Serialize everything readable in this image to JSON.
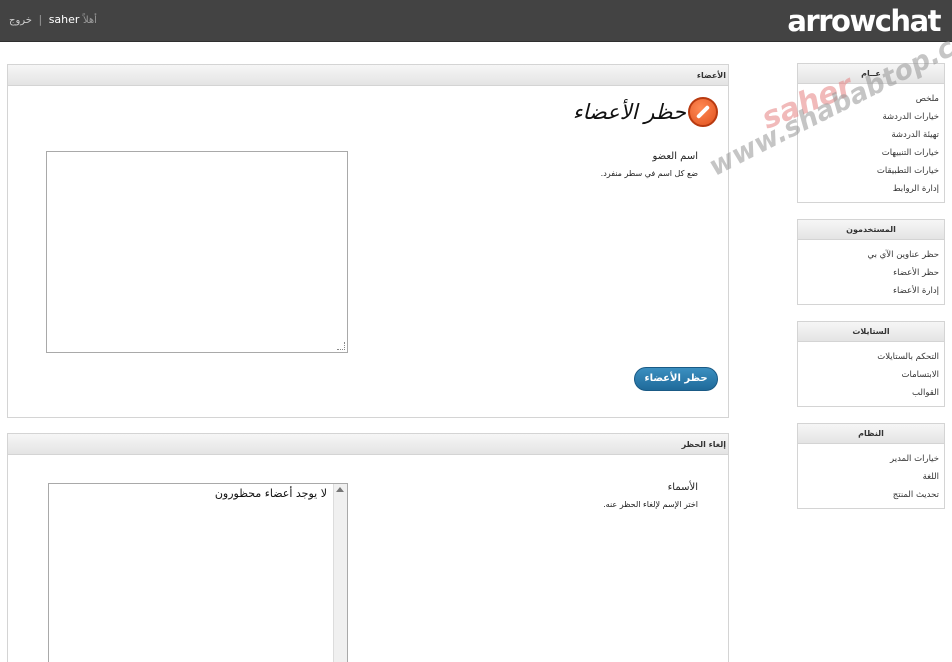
{
  "header": {
    "logo": "arrowchat",
    "greeting": "أهلاً",
    "username": "saher",
    "separator": "|",
    "logout": "خروج"
  },
  "sidebar": {
    "general": {
      "title": "عــام",
      "items": [
        "ملخص",
        "خيارات الدردشة",
        "تهيئة الدردشة",
        "خيارات التنبيهات",
        "خيارات التطبيقات",
        "إدارة الروابط"
      ]
    },
    "users": {
      "title": "المستخدمون",
      "items": [
        "حظر عناوين الآي بي",
        "حظر الأعضاء",
        "إدارة الأعضاء"
      ]
    },
    "styles": {
      "title": "الستايلات",
      "items": [
        "التحكم بالستايلات",
        "الابتسامات",
        "القوالب"
      ]
    },
    "system": {
      "title": "النظام",
      "items": [
        "خيارات المدير",
        "اللغة",
        "تحديث المنتج"
      ]
    }
  },
  "members_panel": {
    "header": "الأعضاء",
    "page_title": "حظر الأعضاء",
    "field_label": "اسم العضو",
    "field_help": "ضع كل اسم في سطر منفرد.",
    "button": "حظر الأعضاء"
  },
  "unban_panel": {
    "header": "إلغاء الحظر",
    "field_label": "الأسماء",
    "field_help": "اختر الإسم لإلغاء الحظر عنه.",
    "list_item": "لا يوجد أعضاء محظورون"
  },
  "watermark": {
    "name": "saher",
    "site": "www.shababtop.com"
  },
  "colors": {
    "topbar": "#434343",
    "button": "#2a7db0",
    "icon": "#e0501c"
  },
  "icons": {
    "ban": "ban-icon",
    "resize": "resize-grip-icon",
    "scroll_up": "scroll-up-icon"
  }
}
